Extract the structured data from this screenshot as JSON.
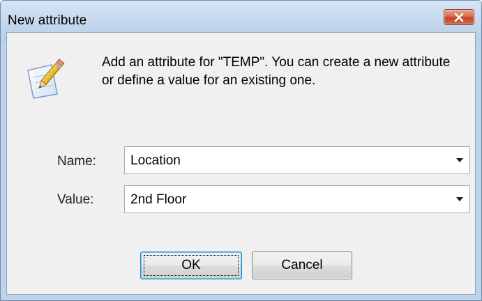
{
  "window": {
    "title": "New attribute"
  },
  "message": "Add an attribute for \"TEMP\". You can create a new attribute or define a value for an existing one.",
  "fields": {
    "name_label": "Name:",
    "name_value": "Location",
    "value_label": "Value:",
    "value_value": "2nd Floor"
  },
  "buttons": {
    "ok": "OK",
    "cancel": "Cancel"
  },
  "icons": {
    "title_close": "close-icon",
    "dialog": "pencil-notepad-icon",
    "dropdown": "chevron-down-icon"
  },
  "colors": {
    "close_button": "#c4472a",
    "title_bar": "#c2d7ee",
    "client_bg": "#f0f0f0",
    "default_button_border": "#3c7fb1"
  }
}
